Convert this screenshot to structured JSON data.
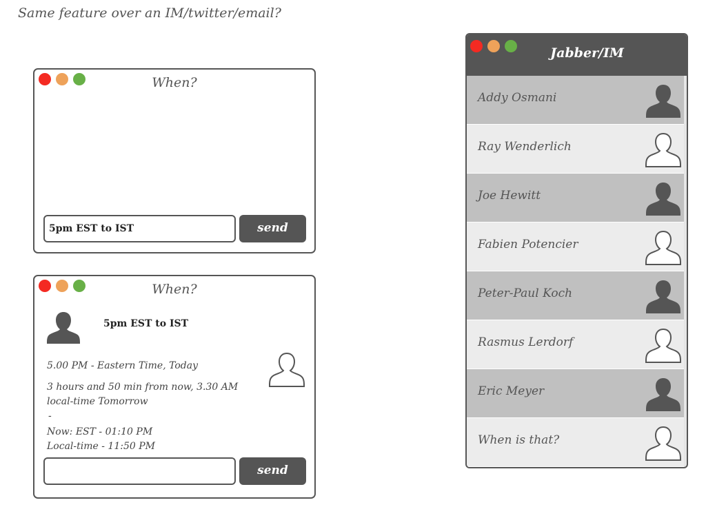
{
  "heading": "Same feature over an IM/twitter/email?",
  "window1": {
    "title": "When?",
    "input_value": "5pm EST to IST",
    "send_label": "send"
  },
  "window2": {
    "title": "When?",
    "sent_message": "5pm EST to IST",
    "reply_lines": [
      "5.00 PM - Eastern Time, Today",
      "3 hours and 50 min from now, 3.30 AM",
      "local-time Tomorrow",
      "-",
      "Now: EST - 01:10 PM",
      "Local-time - 11:50 PM"
    ],
    "input_value": "",
    "send_label": "send"
  },
  "jabber": {
    "title": "Jabber/IM",
    "contacts": [
      {
        "name": "Addy Osmani",
        "online": true
      },
      {
        "name": "Ray Wenderlich",
        "online": false
      },
      {
        "name": "Joe Hewitt",
        "online": true
      },
      {
        "name": "Fabien Potencier",
        "online": false
      },
      {
        "name": "Peter-Paul Koch",
        "online": true
      },
      {
        "name": "Rasmus Lerdorf",
        "online": false
      },
      {
        "name": "Eric Meyer",
        "online": true
      },
      {
        "name": "When is that?",
        "online": false
      }
    ]
  },
  "colors": {
    "dark": "#555555",
    "red": "#f42a22",
    "orange": "#eea25a",
    "green": "#68b047"
  }
}
